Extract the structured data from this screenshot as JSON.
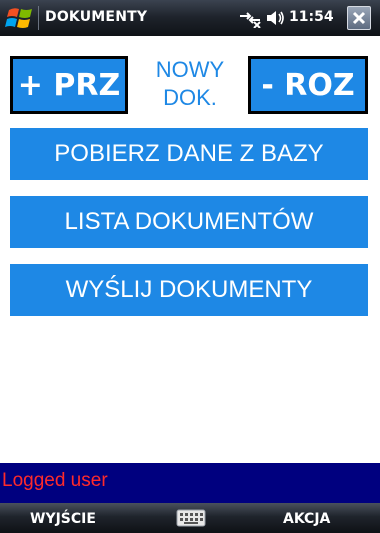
{
  "titlebar": {
    "title": "DOKUMENTY",
    "time": "11:54",
    "icons": [
      "windows-start-icon",
      "connectivity-icon",
      "volume-icon",
      "close-icon"
    ]
  },
  "top_row": {
    "receive_button": "+ PRZ",
    "new_doc_line1": "NOWY",
    "new_doc_line2": "DOK.",
    "issue_button": "- ROZ"
  },
  "menu": {
    "fetch_button": "POBIERZ DANE Z BAZY",
    "list_button": "LISTA DOKUMENTÓW",
    "send_button": "WYŚLIJ DOKUMENTY"
  },
  "status": {
    "text": "Logged user"
  },
  "softkeys": {
    "left": "WYJŚCIE",
    "right": "AKCJA",
    "center_icon": "keyboard-icon"
  },
  "colors": {
    "accent": "#1e88e5",
    "status_bg": "#00007f",
    "status_text": "#ff2a2a"
  }
}
